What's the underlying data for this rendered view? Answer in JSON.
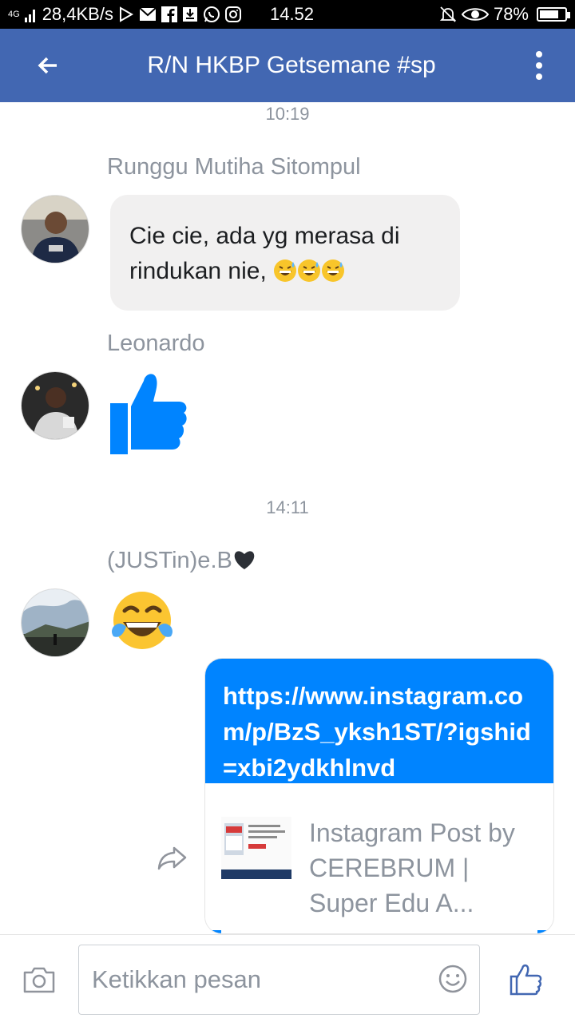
{
  "status_bar": {
    "network": "4G",
    "speed": "28,4KB/s",
    "time": "14.52",
    "battery": "78%",
    "battery_level": 0.78,
    "icons": [
      "signal-icon",
      "play-store-icon",
      "gmail-icon",
      "facebook-icon",
      "download-icon",
      "whatsapp-icon",
      "instagram-icon",
      "mute-icon",
      "eye-icon",
      "battery-icon"
    ]
  },
  "header": {
    "title": "R/N HKBP Getsemane #sp",
    "back_icon": "back-arrow-icon",
    "menu_icon": "more-vertical-icon",
    "bg_color": "#4267b2"
  },
  "messages": [
    {
      "type": "timestamp",
      "text": "10:19"
    },
    {
      "type": "text",
      "sender": "Runggu Mutiha Sitompul",
      "text": "Cie cie, ada yg merasa di rindukan nie,",
      "emojis": [
        "grinning-sweat-emoji",
        "grinning-sweat-emoji",
        "grinning-sweat-emoji"
      ]
    },
    {
      "type": "like",
      "sender": "Leonardo",
      "icon": "thumbs-up-icon"
    },
    {
      "type": "timestamp",
      "text": "14:11"
    },
    {
      "type": "emoji",
      "sender": "(JUSTin)e.B",
      "sender_emoji": "black-heart-emoji",
      "icon": "tears-of-joy-emoji"
    },
    {
      "type": "link",
      "url": "https://www.instagram.com/p/BzS_yksh1ST/?igshid=xbi2ydkhlnvd",
      "preview_title": "Instagram Post by CEREBRUM | Super Edu A...",
      "bubble_color": "#0084ff"
    }
  ],
  "composer": {
    "placeholder": "Ketikkan pesan",
    "camera_icon": "camera-icon",
    "emoji_icon": "smiley-icon",
    "like_icon": "thumbs-up-icon"
  }
}
